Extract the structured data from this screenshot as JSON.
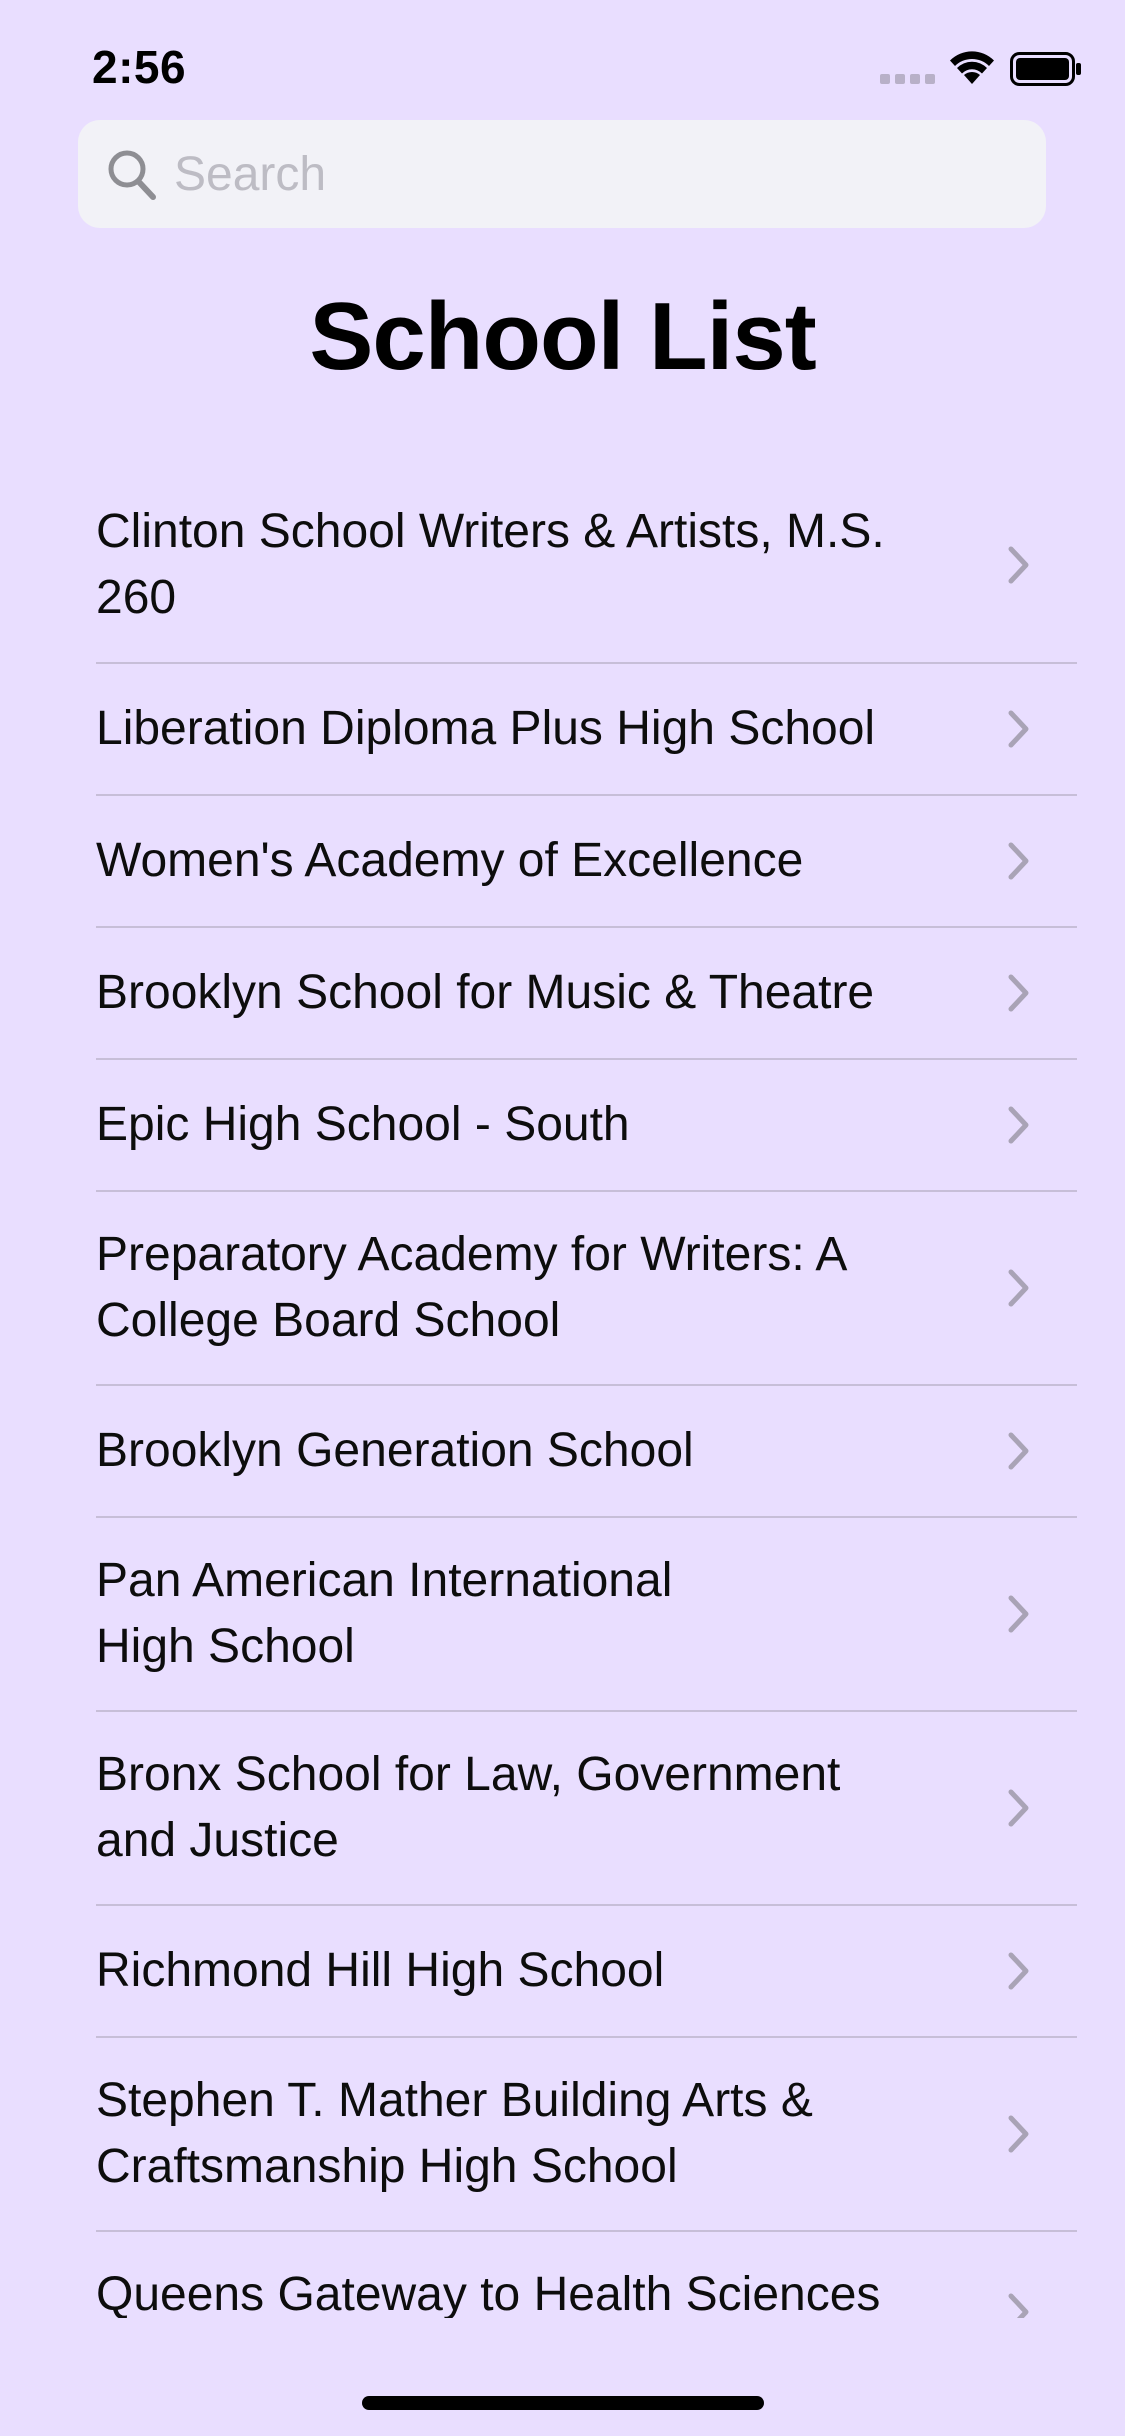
{
  "status_bar": {
    "time": "2:56"
  },
  "search": {
    "placeholder": "Search",
    "value": ""
  },
  "header": {
    "title": "School List"
  },
  "schools": [
    "Clinton School Writers & Artists, M.S. 260",
    "Liberation Diploma Plus High School",
    "Women's Academy of Excellence",
    "Brooklyn School for Music & Theatre",
    "Epic High School - South",
    "Preparatory Academy for Writers: A College Board School",
    "Brooklyn Generation School",
    "Pan American International High School",
    "Bronx School for Law, Government and Justice",
    "Richmond Hill High School",
    "Stephen T. Mather Building Arts & Craftsmanship High School",
    "Queens Gateway to Health Sciences"
  ],
  "icons": {
    "search": "search-icon",
    "row_disclosure": "chevron-right-icon",
    "wifi": "wifi-icon",
    "battery": "battery-icon",
    "signal": "cellular-signal-icon"
  },
  "colors": {
    "background": "#E9DEFF",
    "search_field": "#F2F2F7",
    "separator": "#C7BED8",
    "chevron": "#A9A3B6"
  }
}
